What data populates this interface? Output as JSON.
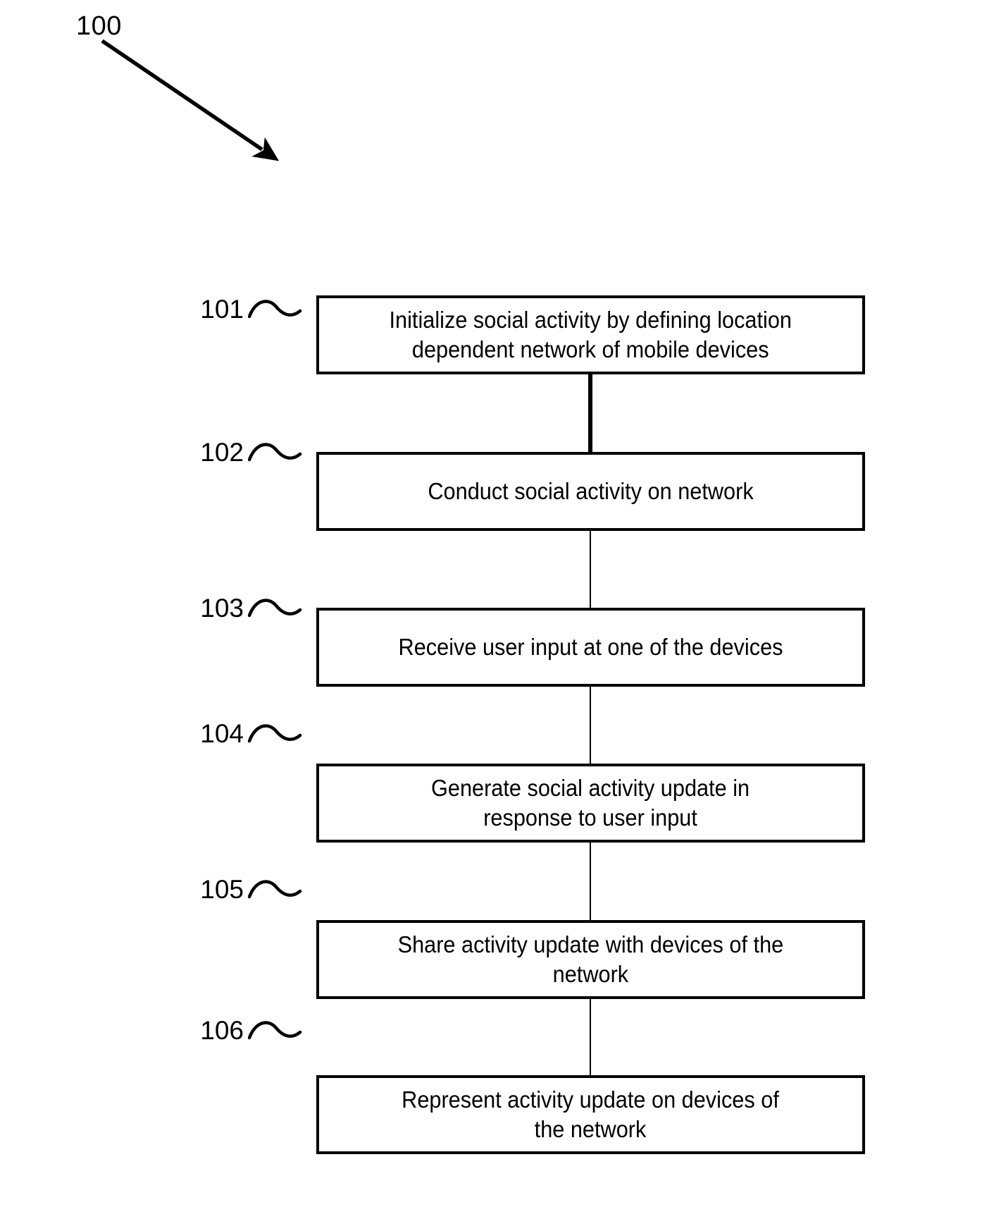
{
  "figure": {
    "number": "100",
    "lead_arrow": "diagonal-arrow-down-right"
  },
  "flowchart": {
    "type": "flowchart",
    "orientation": "vertical",
    "connector_style": "straight-vertical-line",
    "steps": [
      {
        "ref": "101",
        "text": "Initialize social activity by defining location dependent network of mobile devices",
        "lines": [
          "Initialize social activity by defining location",
          "dependent network of mobile devices"
        ]
      },
      {
        "ref": "102",
        "text": "Conduct social activity on network",
        "lines": [
          "Conduct social activity on network"
        ]
      },
      {
        "ref": "103",
        "text": "Receive user input at one of the devices",
        "lines": [
          "Receive user input at one of the devices"
        ]
      },
      {
        "ref": "104",
        "text": "Generate social activity update in response to user input",
        "lines": [
          "Generate social activity update in",
          "response to user input"
        ]
      },
      {
        "ref": "105",
        "text": "Share activity update with devices of the network",
        "lines": [
          "Share activity update with devices of the",
          "network"
        ]
      },
      {
        "ref": "106",
        "text": "Represent activity update on devices of the network",
        "lines": [
          "Represent activity update on devices of",
          "the network"
        ]
      }
    ]
  },
  "colors": {
    "stroke": "#000000",
    "background": "#ffffff"
  }
}
